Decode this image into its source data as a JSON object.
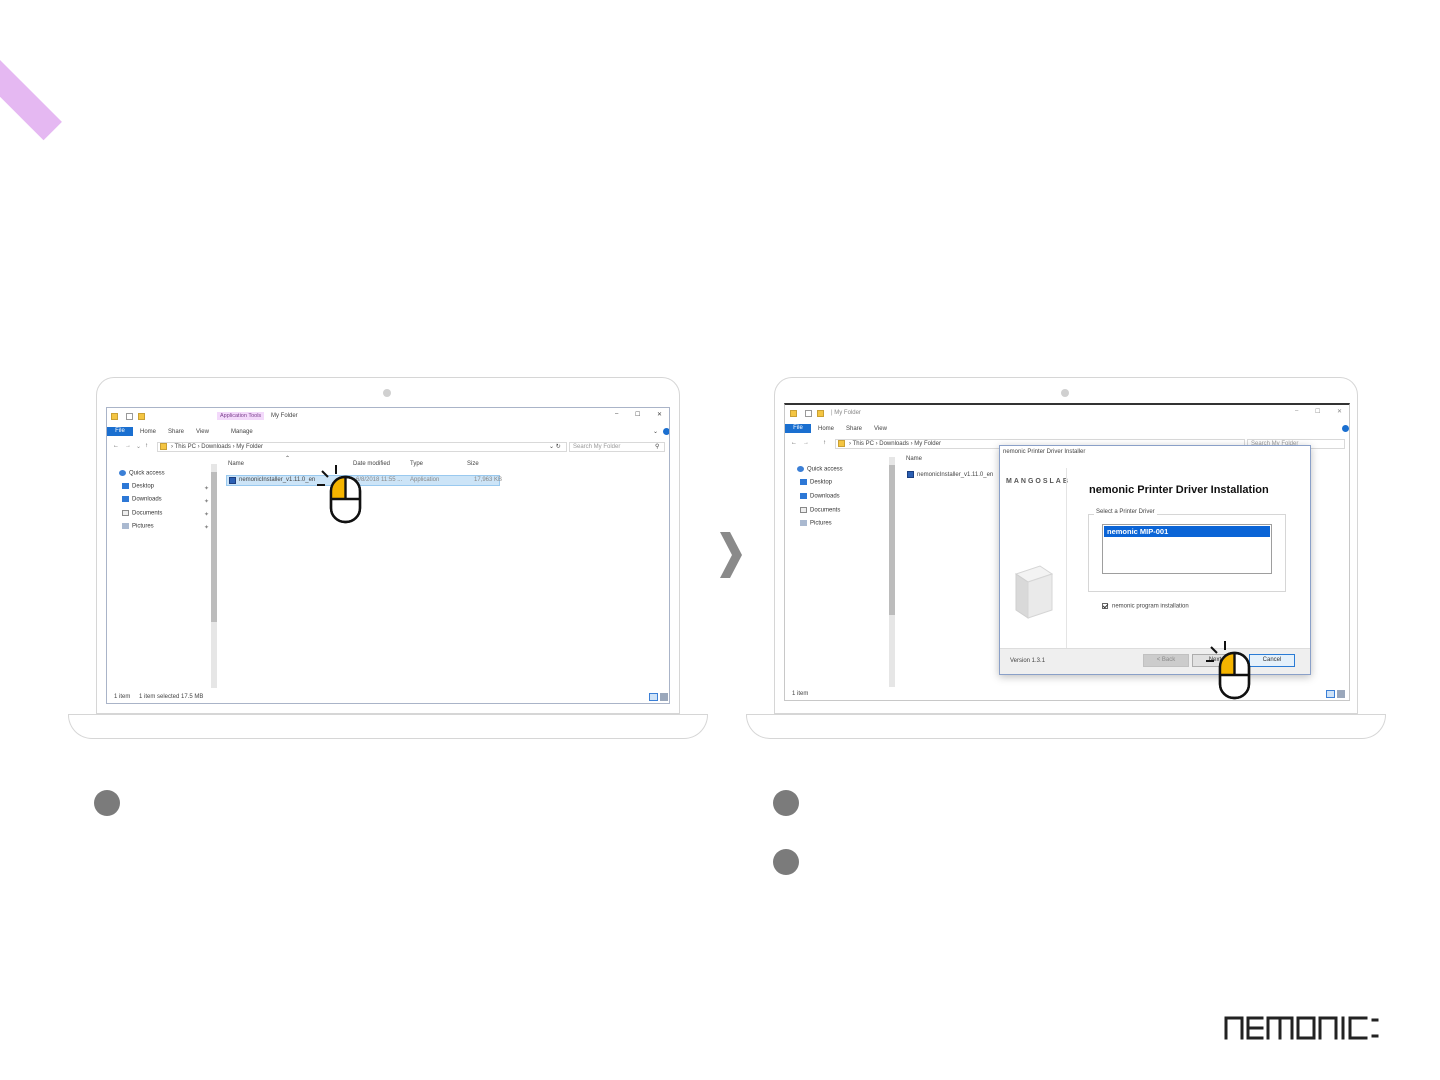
{
  "left_screen": {
    "ribbon_tab_app_tools": "Application Tools",
    "ribbon_title": "My Folder",
    "ribbon_tabs": [
      "File",
      "Home",
      "Share",
      "View"
    ],
    "manage_tab": "Manage",
    "address": [
      "This PC",
      "Downloads",
      "My Folder"
    ],
    "search_placeholder": "Search My Folder",
    "nav": [
      "Quick access",
      "Desktop",
      "Downloads",
      "Documents",
      "Pictures"
    ],
    "columns": [
      "Name",
      "Date modified",
      "Type",
      "Size"
    ],
    "file": {
      "name": "nemonicInstaller_v1.11.0_en",
      "date": "6/8/2018 11:55 ...",
      "type": "Application",
      "size": "17,963 KB"
    },
    "status": [
      "1 item",
      "1 item selected  17.5 MB"
    ]
  },
  "right_screen": {
    "title": "My Folder",
    "ribbon_tabs": [
      "File",
      "Home",
      "Share",
      "View"
    ],
    "address": [
      "This PC",
      "Downloads",
      "My Folder"
    ],
    "search_placeholder": "Search My Folder",
    "nav": [
      "Quick access",
      "Desktop",
      "Downloads",
      "Documents",
      "Pictures"
    ],
    "column_name": "Name",
    "file_name": "nemonicInstaller_v1.11.0_en",
    "status": "1 item",
    "dialog": {
      "window_title": "nemonic Printer Driver Installer",
      "logo": "MANGOSLAB",
      "heading": "nemonic Printer Driver Installation",
      "group_label": "Select a Printer Driver",
      "selected_driver": "nemonic MIP-001",
      "checkbox_label": "nemonic program installation",
      "version": "Version 1.3.1",
      "back_label": "< Back",
      "next_label": "Next",
      "cancel_label": "Cancel"
    }
  },
  "brand": "nemonic",
  "colors": {
    "accent_stripe": "#e5b8f2",
    "mouse_highlight": "#f5b400",
    "selection_blue": "#0a64d6",
    "step_dot": "#7b7b7b"
  }
}
